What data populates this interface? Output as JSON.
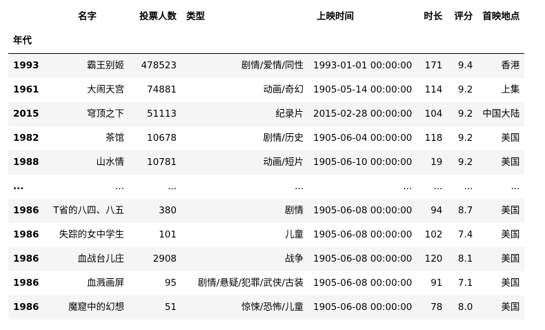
{
  "columns": {
    "name": "名字",
    "votes": "投票人数",
    "type": "类型",
    "release": "上映时间",
    "duration": "时长",
    "score": "评分",
    "place": "首映地点"
  },
  "index_name": "年代",
  "rows": [
    {
      "year": "1993",
      "name": "霸王别姬",
      "votes": "478523",
      "type": "剧情/爱情/同性",
      "release": "1993-01-01 00:00:00",
      "duration": "171",
      "score": "9.4",
      "place": "香港"
    },
    {
      "year": "1961",
      "name": "大闹天宫",
      "votes": "74881",
      "type": "动画/奇幻",
      "release": "1905-05-14 00:00:00",
      "duration": "114",
      "score": "9.2",
      "place": "上集"
    },
    {
      "year": "2015",
      "name": "穹顶之下",
      "votes": "51113",
      "type": "纪录片",
      "release": "2015-02-28 00:00:00",
      "duration": "104",
      "score": "9.2",
      "place": "中国大陆"
    },
    {
      "year": "1982",
      "name": "茶馆",
      "votes": "10678",
      "type": "剧情/历史",
      "release": "1905-06-04 00:00:00",
      "duration": "118",
      "score": "9.2",
      "place": "美国"
    },
    {
      "year": "1988",
      "name": "山水情",
      "votes": "10781",
      "type": "动画/短片",
      "release": "1905-06-10 00:00:00",
      "duration": "19",
      "score": "9.2",
      "place": "美国"
    },
    {
      "year": "...",
      "name": "...",
      "votes": "...",
      "type": "...",
      "release": "...",
      "duration": "...",
      "score": "...",
      "place": "..."
    },
    {
      "year": "1986",
      "name": "T省的八四、八五",
      "votes": "380",
      "type": "剧情",
      "release": "1905-06-08 00:00:00",
      "duration": "94",
      "score": "8.7",
      "place": "美国"
    },
    {
      "year": "1986",
      "name": "失踪的女中学生",
      "votes": "101",
      "type": "儿童",
      "release": "1905-06-08 00:00:00",
      "duration": "102",
      "score": "7.4",
      "place": "美国"
    },
    {
      "year": "1986",
      "name": "血战台儿庄",
      "votes": "2908",
      "type": "战争",
      "release": "1905-06-08 00:00:00",
      "duration": "120",
      "score": "8.1",
      "place": "美国"
    },
    {
      "year": "1986",
      "name": "血溅画屏",
      "votes": "95",
      "type": "剧情/悬疑/犯罪/武侠/古装",
      "release": "1905-06-08 00:00:00",
      "duration": "91",
      "score": "7.1",
      "place": "美国"
    },
    {
      "year": "1986",
      "name": "魔窟中的幻想",
      "votes": "51",
      "type": "惊悚/恐怖/儿童",
      "release": "1905-06-08 00:00:00",
      "duration": "78",
      "score": "8.0",
      "place": "美国"
    }
  ]
}
